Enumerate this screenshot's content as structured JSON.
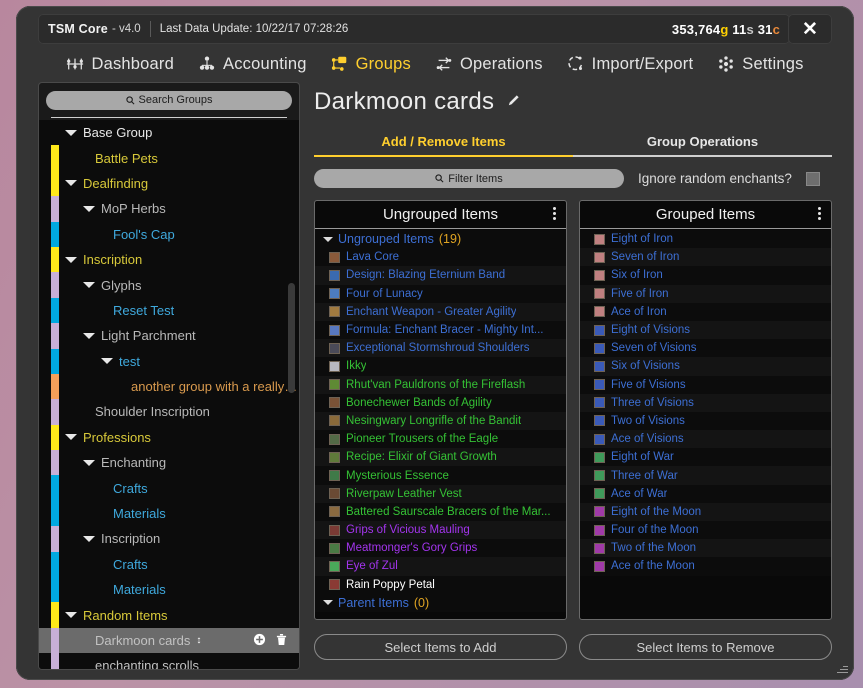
{
  "titlebar": {
    "app_name": "TSM Core",
    "version": "- v4.0",
    "last_update": "Last Data Update: 10/22/17 07:28:26",
    "money": {
      "gold": "353,764",
      "gold_unit": "g",
      "silver": "11",
      "silver_unit": "s",
      "copper": "31",
      "copper_unit": "c"
    },
    "close_label": "✕"
  },
  "nav": {
    "items": [
      {
        "label": "Dashboard",
        "icon": "dashboard-icon",
        "active": false
      },
      {
        "label": "Accounting",
        "icon": "accounting-icon",
        "active": false
      },
      {
        "label": "Groups",
        "icon": "groups-icon",
        "active": true
      },
      {
        "label": "Operations",
        "icon": "operations-icon",
        "active": false
      },
      {
        "label": "Import/Export",
        "icon": "import-export-icon",
        "active": false
      },
      {
        "label": "Settings",
        "icon": "settings-icon",
        "active": false
      }
    ]
  },
  "sidebar": {
    "search_placeholder": "Search Groups",
    "search_icon": "search-icon",
    "tree": [
      {
        "label": "Base Group",
        "indent": 0,
        "swatch": "none",
        "color": "#e8e8e8",
        "expand": true,
        "selected": false
      },
      {
        "label": "Battle Pets",
        "indent": 1,
        "swatch": "#FFE81A",
        "color": "#d8c93a",
        "expand": false,
        "selected": false
      },
      {
        "label": "Dealfinding",
        "indent": 0,
        "swatch": "#FFE81A",
        "color": "#d8c93a",
        "expand": true,
        "selected": false
      },
      {
        "label": "MoP Herbs",
        "indent": 1,
        "swatch": "#C8AFD7",
        "color": "#b9b9b9",
        "expand": true,
        "selected": false
      },
      {
        "label": "Fool's Cap",
        "indent": 2,
        "swatch": "#00A8E0",
        "color": "#3fa9dd",
        "expand": false,
        "selected": false
      },
      {
        "label": "Inscription",
        "indent": 0,
        "swatch": "#FFE81A",
        "color": "#d8c93a",
        "expand": true,
        "selected": false
      },
      {
        "label": "Glyphs",
        "indent": 1,
        "swatch": "#C8AFD7",
        "color": "#b9b9b9",
        "expand": true,
        "selected": false
      },
      {
        "label": "Reset Test",
        "indent": 2,
        "swatch": "#00A8E0",
        "color": "#3fa9dd",
        "expand": false,
        "selected": false
      },
      {
        "label": "Light Parchment",
        "indent": 1,
        "swatch": "#C8AFD7",
        "color": "#b9b9b9",
        "expand": true,
        "selected": false
      },
      {
        "label": "test",
        "indent": 2,
        "swatch": "#00A8E0",
        "color": "#3fa9dd",
        "expand": true,
        "selected": false
      },
      {
        "label": "another group with a really lo...",
        "indent": 3,
        "swatch": "#F5A05A",
        "color": "#d99a4e",
        "expand": false,
        "selected": false
      },
      {
        "label": "Shoulder Inscription",
        "indent": 1,
        "swatch": "#C8AFD7",
        "color": "#b9b9b9",
        "expand": false,
        "selected": false
      },
      {
        "label": "Professions",
        "indent": 0,
        "swatch": "#FFE81A",
        "color": "#d8c93a",
        "expand": true,
        "selected": false
      },
      {
        "label": "Enchanting",
        "indent": 1,
        "swatch": "#C8AFD7",
        "color": "#b9b9b9",
        "expand": true,
        "selected": false
      },
      {
        "label": "Crafts",
        "indent": 2,
        "swatch": "#00A8E0",
        "color": "#3fa9dd",
        "expand": false,
        "selected": false
      },
      {
        "label": "Materials",
        "indent": 2,
        "swatch": "#00A8E0",
        "color": "#3fa9dd",
        "expand": false,
        "selected": false
      },
      {
        "label": "Inscription",
        "indent": 1,
        "swatch": "#C8AFD7",
        "color": "#b9b9b9",
        "expand": true,
        "selected": false
      },
      {
        "label": "Crafts",
        "indent": 2,
        "swatch": "#00A8E0",
        "color": "#3fa9dd",
        "expand": false,
        "selected": false
      },
      {
        "label": "Materials",
        "indent": 2,
        "swatch": "#00A8E0",
        "color": "#3fa9dd",
        "expand": false,
        "selected": false
      },
      {
        "label": "Random Items",
        "indent": 0,
        "swatch": "#FFE81A",
        "color": "#d8c93a",
        "expand": true,
        "selected": false
      },
      {
        "label": "Darkmoon cards",
        "indent": 1,
        "swatch": "#C8AFD7",
        "color": "#c2c2c2",
        "expand": false,
        "selected": true,
        "sort_icon": "sort-updown-icon",
        "add_icon": "add-circle-icon",
        "delete_icon": "trash-icon"
      },
      {
        "label": "enchanting scrolls",
        "indent": 1,
        "swatch": "#C8AFD7",
        "color": "#c2c2c2",
        "expand": false,
        "selected": false
      }
    ]
  },
  "main": {
    "group_title": "Darkmoon cards",
    "edit_icon": "pencil-icon",
    "tabs": [
      {
        "label": "Add / Remove Items",
        "active": true
      },
      {
        "label": "Group Operations",
        "active": false
      }
    ],
    "filter_placeholder": "Filter Items",
    "filter_icon": "search-icon",
    "ignore_random_enchants_label": "Ignore random enchants?",
    "ignore_random_enchants_checked": false,
    "ungrouped_panel": {
      "title": "Ungrouped Items",
      "menu_icon": "kebab-menu-icon",
      "sections": [
        {
          "name": "Ungrouped Items",
          "count": "(19)",
          "expanded": true
        },
        {
          "name": "Parent Items",
          "count": "(0)",
          "expanded": true
        }
      ],
      "items": [
        {
          "name": "Lava Core",
          "color": "#3d6fd4",
          "icon": "#8a5a3a"
        },
        {
          "name": "Design: Blazing Eternium Band",
          "color": "#3d6fd4",
          "icon": "#3a6ab0"
        },
        {
          "name": "Four of Lunacy",
          "color": "#3d6fd4",
          "icon": "#4c7cc0"
        },
        {
          "name": "Enchant Weapon - Greater Agility",
          "color": "#3d6fd4",
          "icon": "#a07a40"
        },
        {
          "name": "Formula: Enchant Bracer - Mighty Int...",
          "color": "#3d6fd4",
          "icon": "#5878c0"
        },
        {
          "name": "Exceptional Stormshroud Shoulders",
          "color": "#3d6fd4",
          "icon": "#4a4a58"
        },
        {
          "name": "Ikky",
          "color": "#35c235",
          "icon": "#b8b8c0"
        },
        {
          "name": "Rhut'van Pauldrons of the Fireflash",
          "color": "#35c235",
          "icon": "#5f8a34"
        },
        {
          "name": "Bonechewer Bands of Agility",
          "color": "#35c235",
          "icon": "#7a5236"
        },
        {
          "name": "Nesingwary Longrifle of the Bandit",
          "color": "#35c235",
          "icon": "#8a6a3a"
        },
        {
          "name": "Pioneer Trousers of the Eagle",
          "color": "#35c235",
          "icon": "#536a46"
        },
        {
          "name": "Recipe: Elixir of Giant Growth",
          "color": "#35c235",
          "icon": "#5f7a3a"
        },
        {
          "name": "Mysterious Essence",
          "color": "#35c235",
          "icon": "#3f7a48"
        },
        {
          "name": "Riverpaw Leather Vest",
          "color": "#35c235",
          "icon": "#6a4a34"
        },
        {
          "name": "Battered Saurscale Bracers of the Mar...",
          "color": "#35c235",
          "icon": "#8a6a40"
        },
        {
          "name": "Grips of Vicious Mauling",
          "color": "#a335ee",
          "icon": "#7a3a34"
        },
        {
          "name": "Meatmonger's Gory Grips",
          "color": "#a335ee",
          "icon": "#4a7a44"
        },
        {
          "name": "Eye of Zul",
          "color": "#a335ee",
          "icon": "#4aa85a"
        },
        {
          "name": "Rain Poppy Petal",
          "color": "#ffffff",
          "icon": "#8a3a34"
        }
      ]
    },
    "grouped_panel": {
      "title": "Grouped Items",
      "menu_icon": "kebab-menu-icon",
      "items": [
        {
          "name": "Eight of Iron",
          "color": "#3d6fd4",
          "icon": "#c08080"
        },
        {
          "name": "Seven of Iron",
          "color": "#3d6fd4",
          "icon": "#c08080"
        },
        {
          "name": "Six of Iron",
          "color": "#3d6fd4",
          "icon": "#c08080"
        },
        {
          "name": "Five of Iron",
          "color": "#3d6fd4",
          "icon": "#c08080"
        },
        {
          "name": "Ace of Iron",
          "color": "#3d6fd4",
          "icon": "#c08080"
        },
        {
          "name": "Eight of Visions",
          "color": "#3d6fd4",
          "icon": "#3a5ab8"
        },
        {
          "name": "Seven of Visions",
          "color": "#3d6fd4",
          "icon": "#3a5ab8"
        },
        {
          "name": "Six of Visions",
          "color": "#3d6fd4",
          "icon": "#3a5ab8"
        },
        {
          "name": "Five of Visions",
          "color": "#3d6fd4",
          "icon": "#3a5ab8"
        },
        {
          "name": "Three of Visions",
          "color": "#3d6fd4",
          "icon": "#3a5ab8"
        },
        {
          "name": "Two of Visions",
          "color": "#3d6fd4",
          "icon": "#3a5ab8"
        },
        {
          "name": "Ace of Visions",
          "color": "#3d6fd4",
          "icon": "#3a5ab8"
        },
        {
          "name": "Eight of War",
          "color": "#3d6fd4",
          "icon": "#3f9a5a"
        },
        {
          "name": "Three of War",
          "color": "#3d6fd4",
          "icon": "#3f9a5a"
        },
        {
          "name": "Ace of War",
          "color": "#3d6fd4",
          "icon": "#3f9a5a"
        },
        {
          "name": "Eight of the Moon",
          "color": "#3d6fd4",
          "icon": "#a03aa8"
        },
        {
          "name": "Four of the Moon",
          "color": "#3d6fd4",
          "icon": "#a03aa8"
        },
        {
          "name": "Two of the Moon",
          "color": "#3d6fd4",
          "icon": "#a03aa8"
        },
        {
          "name": "Ace of the Moon",
          "color": "#3d6fd4",
          "icon": "#a03aa8"
        }
      ]
    },
    "buttons": [
      {
        "label": "Select Items to Add"
      },
      {
        "label": "Select Items to Remove"
      }
    ]
  }
}
